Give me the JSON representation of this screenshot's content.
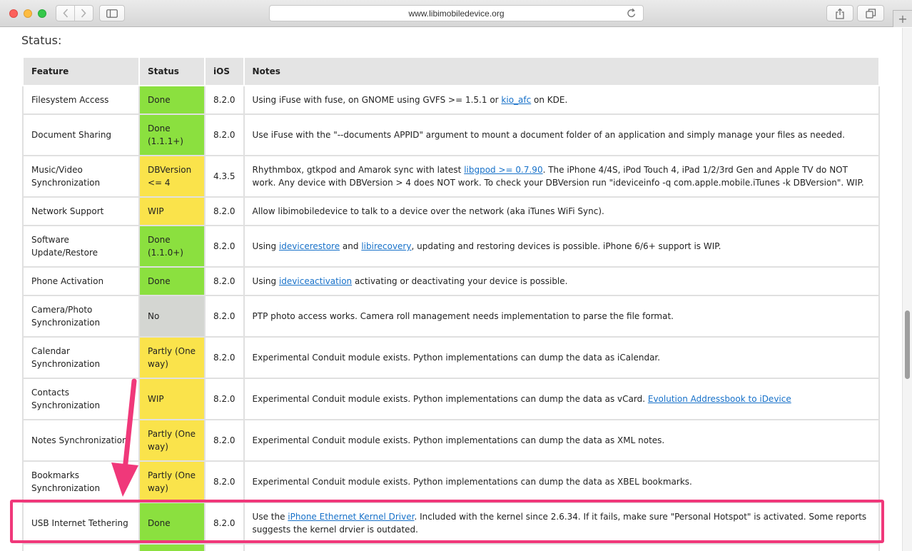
{
  "browser": {
    "url": "www.libimobiledevice.org",
    "new_tab_label": "+"
  },
  "page": {
    "heading": "Status:"
  },
  "table": {
    "headers": {
      "feature": "Feature",
      "status": "Status",
      "ios": "iOS",
      "notes": "Notes"
    },
    "rows": [
      {
        "feature": "Filesystem Access",
        "status": "Done",
        "status_kind": "done",
        "ios": "8.2.0",
        "notes": [
          {
            "text": "Using iFuse with fuse, on GNOME using GVFS >= 1.5.1 or "
          },
          {
            "text": "kio_afc",
            "link": true
          },
          {
            "text": " on KDE."
          }
        ]
      },
      {
        "feature": "Document Sharing",
        "status": "Done (1.1.1+)",
        "status_kind": "done",
        "ios": "8.2.0",
        "notes": [
          {
            "text": "Use iFuse with the \"--documents APPID\" argument to mount a document folder of an application and simply manage your files as needed."
          }
        ]
      },
      {
        "feature": "Music/Video Synchronization",
        "status": "DBVersion <= 4",
        "status_kind": "partly",
        "ios": "4.3.5",
        "notes": [
          {
            "text": "Rhythmbox, gtkpod and Amarok sync with latest "
          },
          {
            "text": "libgpod >= 0.7.90",
            "link": true
          },
          {
            "text": ". The iPhone 4/4S, iPod Touch 4, iPad 1/2/3rd Gen and Apple TV do NOT work. Any device with DBVersion > 4 does NOT work. To check your DBVersion run \"ideviceinfo -q com.apple.mobile.iTunes -k DBVersion\". WIP."
          }
        ]
      },
      {
        "feature": "Network Support",
        "status": "WIP",
        "status_kind": "partly",
        "ios": "8.2.0",
        "notes": [
          {
            "text": "Allow libimobiledevice to talk to a device over the network (aka iTunes WiFi Sync)."
          }
        ]
      },
      {
        "feature": "Software Update/Restore",
        "status": "Done (1.1.0+)",
        "status_kind": "done",
        "ios": "8.2.0",
        "notes": [
          {
            "text": "Using "
          },
          {
            "text": "idevicerestore",
            "link": true
          },
          {
            "text": " and "
          },
          {
            "text": "libirecovery",
            "link": true
          },
          {
            "text": ", updating and restoring devices is possible. iPhone 6/6+ support is WIP."
          }
        ]
      },
      {
        "feature": "Phone Activation",
        "status": "Done",
        "status_kind": "done",
        "ios": "8.2.0",
        "notes": [
          {
            "text": "Using "
          },
          {
            "text": "ideviceactivation",
            "link": true
          },
          {
            "text": " activating or deactivating your device is possible."
          }
        ]
      },
      {
        "feature": "Camera/Photo Synchronization",
        "status": "No",
        "status_kind": "no",
        "ios": "8.2.0",
        "notes": [
          {
            "text": "PTP photo access works. Camera roll management needs implementation to parse the file format."
          }
        ]
      },
      {
        "feature": "Calendar Synchronization",
        "status": "Partly (One way)",
        "status_kind": "partly",
        "ios": "8.2.0",
        "notes": [
          {
            "text": "Experimental Conduit module exists. Python implementations can dump the data as iCalendar."
          }
        ]
      },
      {
        "feature": "Contacts Synchronization",
        "status": "WIP",
        "status_kind": "partly",
        "ios": "8.2.0",
        "notes": [
          {
            "text": "Experimental Conduit module exists. Python implementations can dump the data as vCard. "
          },
          {
            "text": "Evolution Addressbook to iDevice",
            "link": true
          }
        ]
      },
      {
        "feature": "Notes Synchronization",
        "status": "Partly (One way)",
        "status_kind": "partly",
        "ios": "8.2.0",
        "notes": [
          {
            "text": "Experimental Conduit module exists. Python implementations can dump the data as XML notes."
          }
        ]
      },
      {
        "feature": "Bookmarks Synchronization",
        "status": "Partly (One way)",
        "status_kind": "partly",
        "ios": "8.2.0",
        "notes": [
          {
            "text": "Experimental Conduit module exists. Python implementations can dump the data as XBEL bookmarks."
          }
        ]
      },
      {
        "feature": "USB Internet Tethering",
        "status": "Done",
        "status_kind": "done",
        "ios": "8.2.0",
        "highlighted": true,
        "notes": [
          {
            "text": "Use the "
          },
          {
            "text": "iPhone Ethernet Kernel Driver",
            "link": true
          },
          {
            "text": ". Included with the kernel since 2.6.34. If it fails, make sure \"Personal Hotspot\" is activated. Some reports suggests the kernel drvier is outdated."
          }
        ]
      },
      {
        "feature": "",
        "status": "",
        "status_kind": "done",
        "ios": "",
        "notes": []
      }
    ]
  },
  "colors": {
    "done": "#8be03f",
    "partly": "#fae34b",
    "no": "#d4d6d2",
    "highlight": "#f0387a",
    "link": "#1771c9"
  },
  "icons": {
    "back": "chevron-left-icon",
    "forward": "chevron-right-icon",
    "sidebar": "sidebar-icon",
    "reload": "reload-icon",
    "share": "share-icon",
    "tabs": "tabs-icon"
  }
}
